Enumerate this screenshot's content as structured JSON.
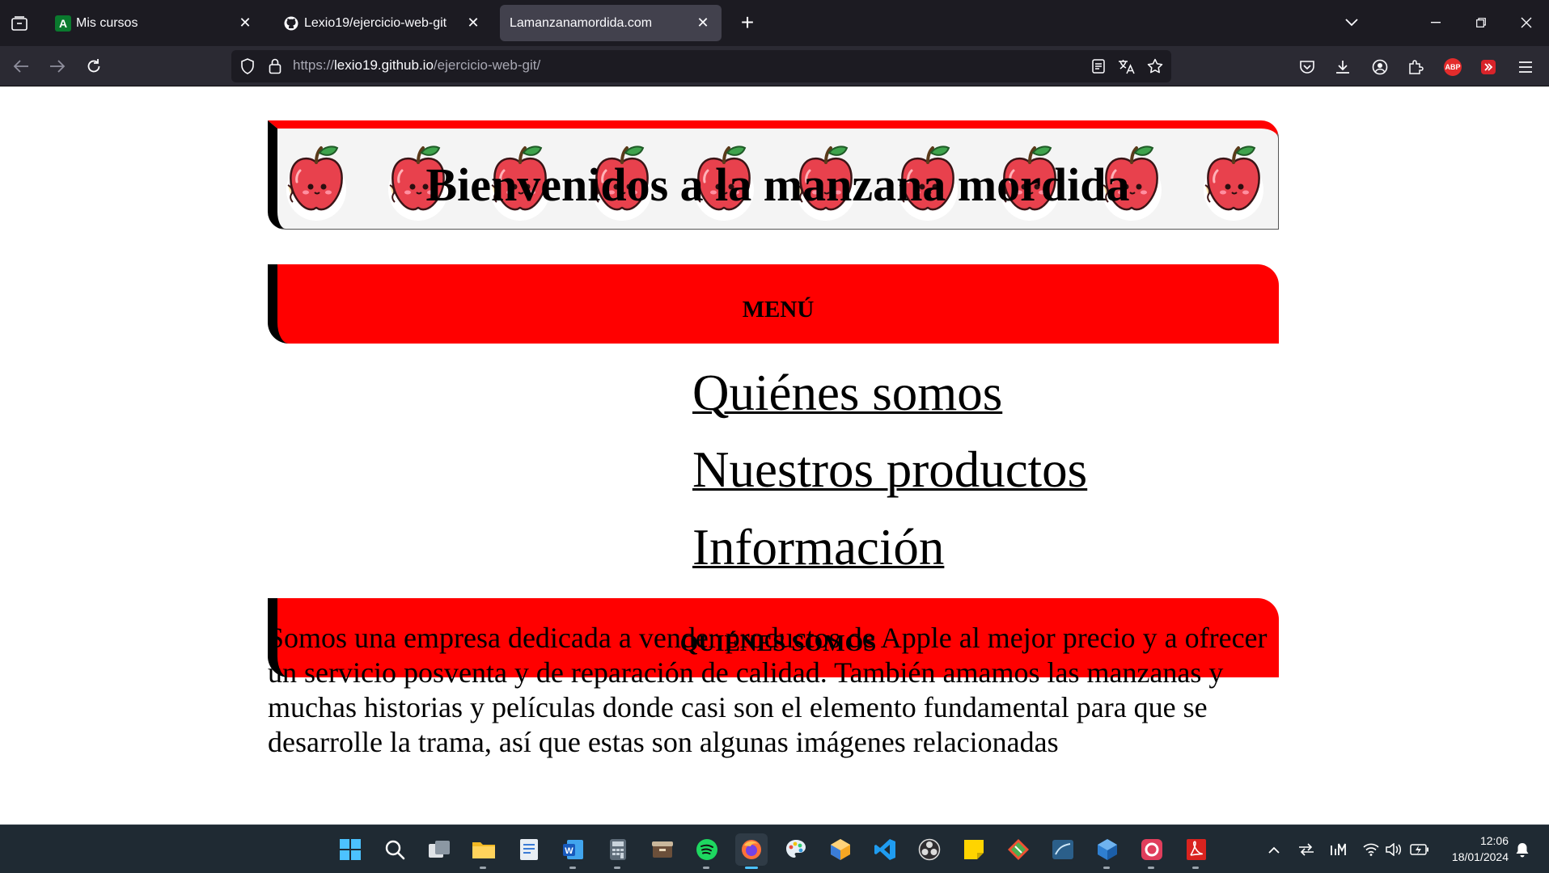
{
  "browser": {
    "tabs": [
      {
        "title": "Mis cursos",
        "active": false
      },
      {
        "title": "Lexio19/ejercicio-web-git",
        "active": false
      },
      {
        "title": "Lamanzanamordida.com",
        "active": true
      }
    ],
    "url": {
      "scheme": "https://",
      "host": "lexio19.github.io",
      "path": "/ejercicio-web-git/"
    },
    "extension_badges": {
      "adblock": "ABP"
    }
  },
  "page": {
    "banner_title": "Bienvenidos a la manzana mordida",
    "menu_heading": "MENÚ",
    "menu_links": [
      "Quiénes somos",
      "Nuestros productos",
      "Información"
    ],
    "section_heading": "QUIÉNES SOMOS",
    "paragraph": "Somos una empresa dedicada a vender productos de Apple al mejor precio y a ofrecer un servicio posventa y de reparación de calidad. También amamos las manzanas y muchas historias y películas donde casi son el elemento fundamental para que se desarrolle la trama, así que estas son algunas imágenes relacionadas"
  },
  "taskbar": {
    "time": "12:06",
    "date": "18/01/2024"
  },
  "colors": {
    "accent_red": "#ff0000",
    "tab_bg": "#1c1b22",
    "toolbar_bg": "#2b2a33",
    "taskbar_bg": "#1f2a33"
  }
}
